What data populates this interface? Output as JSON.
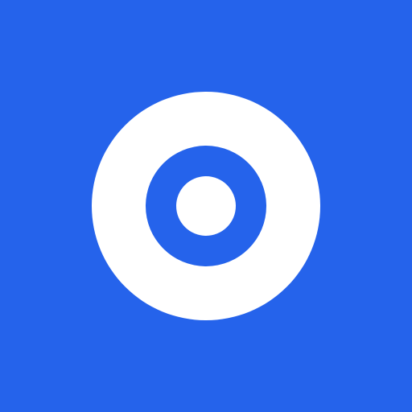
{
  "icon": {
    "name": "target-icon",
    "background_color": "#2563eb",
    "foreground_color": "#ffffff"
  }
}
